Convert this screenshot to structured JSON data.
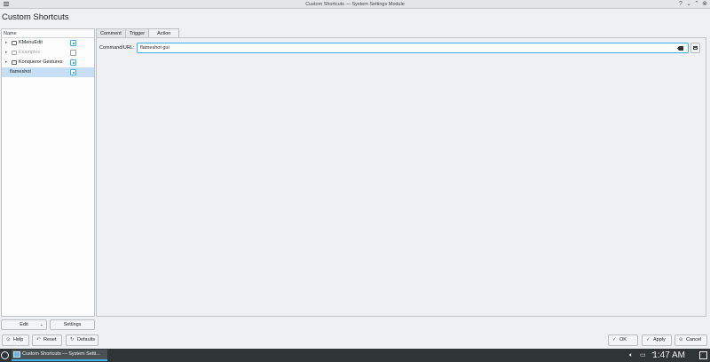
{
  "window": {
    "title": "Custom Shortcuts — System Settings Module",
    "buttons": {
      "help": "?",
      "minimize": "⌄",
      "maximize": "⌃",
      "close": "⊗"
    }
  },
  "page_title": "Custom Shortcuts",
  "tree": {
    "header": "Name",
    "items": [
      {
        "label": "KMenuEdit",
        "checked": true,
        "dimmed": false
      },
      {
        "label": "Examples",
        "checked": false,
        "dimmed": true
      },
      {
        "label": "Konqueror Gestures",
        "checked": true,
        "dimmed": false
      },
      {
        "label": "flameshot",
        "checked": true,
        "selected": true
      }
    ]
  },
  "left_buttons": {
    "edit": "Edit",
    "settings": "Settings"
  },
  "tabs": [
    {
      "label": "Comment",
      "active": false
    },
    {
      "label": "Trigger",
      "active": false
    },
    {
      "label": "Action",
      "active": true
    }
  ],
  "action": {
    "command_label": "Command/URL:",
    "command_value": "flameshot gui"
  },
  "bottom_buttons": {
    "help": "Help",
    "reset": "Reset",
    "defaults": "Defaults",
    "ok": "OK",
    "apply": "Apply",
    "cancel": "Cancel"
  },
  "taskbar": {
    "task_label": "Custom Shortcuts — System Setti...",
    "clock": "1:47 AM"
  },
  "colors": {
    "accent": "#3daee9",
    "taskbar": "#2f3437",
    "selection": "#c7dff5"
  }
}
